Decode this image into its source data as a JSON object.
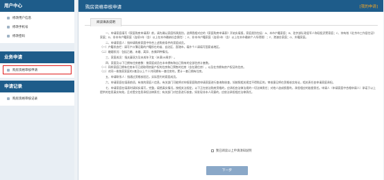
{
  "sidebar": {
    "user_center": {
      "title": "用户中心",
      "items": [
        "修改用户信息",
        "修改手机号",
        "修改密码"
      ]
    },
    "business": {
      "title": "业务申请",
      "items": [
        "购房资格审核申请"
      ]
    },
    "records": {
      "title": "申请记录",
      "items": [
        "购房资格审核记录"
      ]
    }
  },
  "main": {
    "title": "购房资格审核申请",
    "back_link": "[我的申请]",
    "tab": "阅读填表说明",
    "notice": [
      "一、申请家庭填写《家庭购房申请表》前，请先确认家庭所属类别，选择我相对应的《家庭购房申请表》开始实填报，家庭类别包括：A、本市户籍家庭；B、驻京部队现役军人和现役武警家庭；C、持有效《北京市工作居住证》家庭；D、非本市户籍家庭（连续5年（含）以上在本市缴纳社会保险）；E、非本市户籍家庭（连续5年（含）以上在本市缴纳个人所得税）；F、港澳台家庭；G、外籍家庭。",
      "二、申请家庭人：指申请购房家庭中符合上述购房条件的家庭成员。\n（一）户籍状态栏：请写户口簿记载的户籍所在的省、自治区、直辖市，填外个人请填写国家或地区。\n（二）婚姻状况：包括已婚、未婚、离异、丧偶四种情况。",
      "三、家庭成员：指夫妻双方及未成年子女（未满18周岁）。",
      "四、家庭及以下已拥有住房套数：按家庭成员在本市拥有和自己购有的全部住房计套数。\n（一）同样家庭已拥有住房未写已经取得房屋产权的住房和已预售的住房（含在建住房），以及在京拥有房产权证的住房。\n（二）对同一栋独家家庭的2套及以上个人共同拥有一套住房的，累计一套已拥有住房。",
      "五、申请联系人：指通过资格核验后，实际签约的家庭成员。",
      "六、申请家庭在填表前须，有效的家庭人信息，有关部门可能将对申报家庭购房申请家庭进行查询和核查，如按照相关规定不得购买的，审核意见将在资格核实结论，相关责任由申请家庭承担。",
      "七、申请家庭在填表时请如实填写，完整，填错真实情况，按相关法规定，以下正在依法购房资格的，应承担由法律法规的一切法律责任；对他人造成损害的，承担相应的赔偿责任。申请人（申请家庭中合格申请人）承诺于以上提供的信息真实有效，且对提交信息承担法律责任；有关部门对信息进行核查，如发现非本人同意的，应依法承担相应法律责任。"
    ],
    "agree_label": "我已阅读以上申请须知说明",
    "next_button": "下一步"
  }
}
